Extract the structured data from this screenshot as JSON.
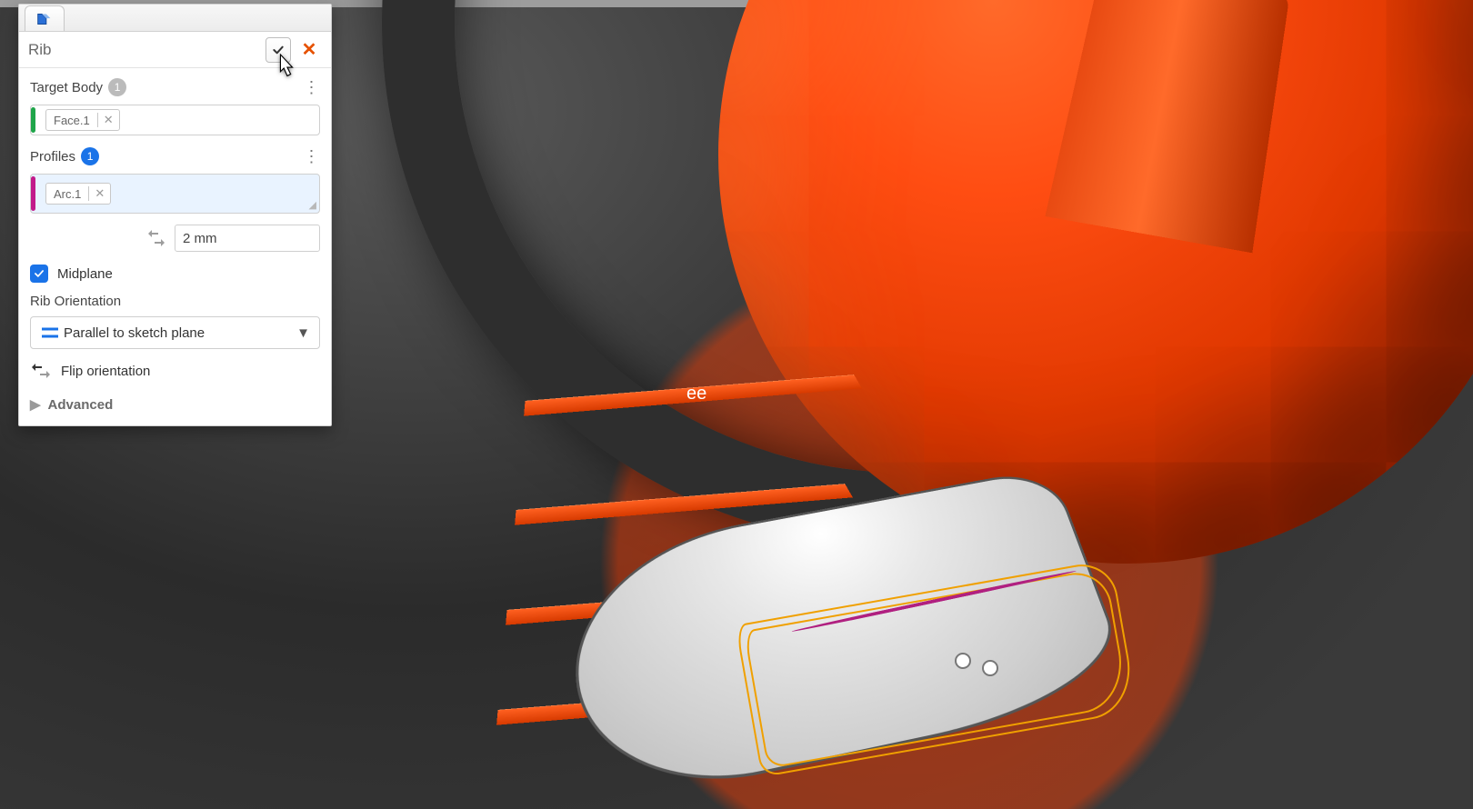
{
  "panel": {
    "title": "Rib",
    "target": {
      "label": "Target Body",
      "count": "1",
      "chip": "Face.1"
    },
    "profiles": {
      "label": "Profiles",
      "count": "1",
      "chip": "Arc.1"
    },
    "thickness": {
      "value": "2 mm"
    },
    "midplane": {
      "label": "Midplane",
      "checked": true
    },
    "orientation": {
      "label": "Rib Orientation",
      "selected": "Parallel to sketch plane"
    },
    "flip": {
      "label": "Flip orientation"
    },
    "advanced": {
      "label": "Advanced"
    }
  },
  "viewport": {
    "annotation": "ee"
  }
}
